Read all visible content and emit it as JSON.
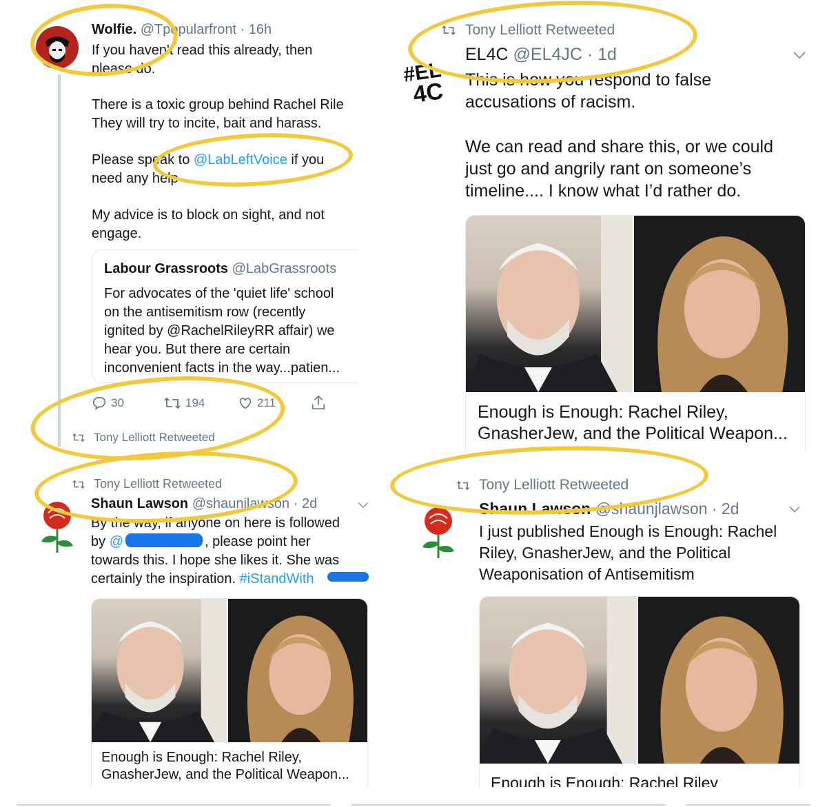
{
  "panel_tl": {
    "tweet": {
      "display_name": "Wolfie.",
      "handle": "@Tpopularfront",
      "time": "16h",
      "line1": "If you haven't read this already, then",
      "line2": "please do.",
      "para2_line1": "There is a toxic group behind Rachel Rile",
      "para2_line2": "They will try to incite, bait and harass.",
      "para3_prefix": "Please speak to ",
      "para3_mention": "@LabLeftVoice",
      "para3_suffix": " if you",
      "para3_line2": "need any help",
      "para4_line1": "My advice is to block on sight, and not",
      "para4_line2": "engage."
    },
    "quoted": {
      "display_name": "Labour Grassroots",
      "handle": "@LabGrassroots",
      "lines": [
        "For advocates of the 'quiet life' school",
        "on the antisemitism row (recently",
        "ignited by @RachelRileyRR affair) we",
        "hear you. But there are certain",
        "inconvenient facts in the way...patien..."
      ]
    },
    "actions": {
      "replies": "30",
      "retweets": "194",
      "likes": "211"
    },
    "retweeted_by": "Tony Lelliott Retweeted"
  },
  "panel_tr": {
    "retweeted_by": "Tony Lelliott Retweeted",
    "display_name": "EL4C",
    "handle": "@EL4JC",
    "time": "1d",
    "avatar_text": "#EL 4C",
    "text_lines": [
      "This is how you respond to false",
      "accusations of racism."
    ],
    "text_lines2": [
      "We can read and share this, or we could",
      "just go and angrily rant on someone’s",
      "timeline.... I know what I’d rather do."
    ],
    "card_title_lines": [
      "Enough is Enough: Rachel Riley,",
      "GnasherJew, and the Political Weapon..."
    ]
  },
  "panel_bl": {
    "retweeted_by": "Tony Lelliott Retweeted",
    "display_name": "Shaun Lawson",
    "handle": "@shaunjlawson",
    "time": "2d",
    "line1": "By the way, if anyone on here is followed",
    "line2_prefix": "by ",
    "line2_mention": "@",
    "line2_suffix": ", please point her",
    "line3": "towards this. I hope she likes it. She was",
    "line4_prefix": "certainly the inspiration. ",
    "line4_hashtag": "#iStandWith",
    "card_title_lines": [
      "Enough is Enough: Rachel Riley,",
      "GnasherJew, and the Political Weapon..."
    ]
  },
  "panel_br": {
    "retweeted_by": "Tony Lelliott Retweeted",
    "display_name": "Shaun Lawson",
    "handle": "@shaunjlawson",
    "time": "2d",
    "text_lines": [
      "I just published Enough is Enough: Rachel",
      "Riley, GnasherJew, and the Political",
      "Weaponisation of Antisemitism"
    ],
    "card_title_lines": [
      "Enough is Enough: Rachel Riley"
    ]
  },
  "colors": {
    "highlight": "#f3c83a",
    "link": "#1da1f2",
    "muted": "#657786",
    "redaction": "#1a73e8"
  }
}
